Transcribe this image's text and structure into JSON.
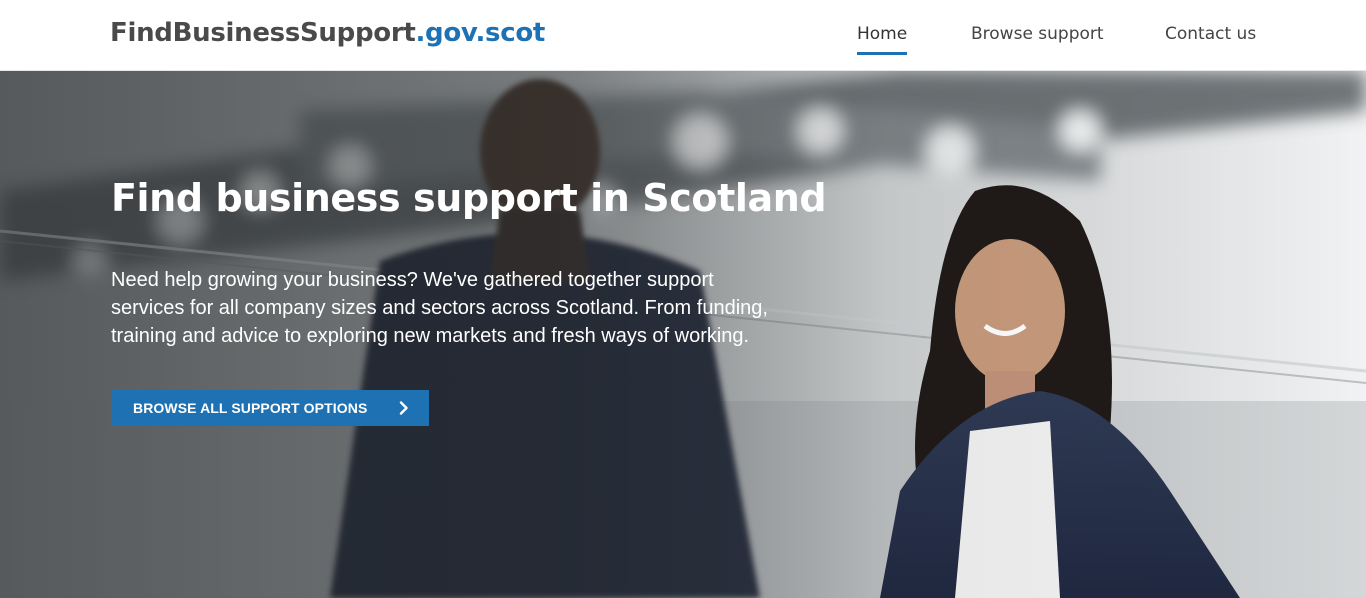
{
  "header": {
    "logo_main": "FindBusinessSupport",
    "logo_domain": ".gov.scot",
    "nav": {
      "home": "Home",
      "browse": "Browse support",
      "contact": "Contact us"
    },
    "active_nav": "home"
  },
  "hero": {
    "title": "Find business support in Scotland",
    "text": "Need help growing your business? We've gathered together support services for all company sizes and sectors across Scotland. From funding, training and advice to exploring new markets and fresh ways of working.",
    "button_label": "BROWSE ALL SUPPORT OPTIONS",
    "button_icon": "chevron-right-icon"
  },
  "colors": {
    "brand_blue": "#1e72b3",
    "logo_grey": "#4a4a4a",
    "hero_text": "#ffffff"
  }
}
